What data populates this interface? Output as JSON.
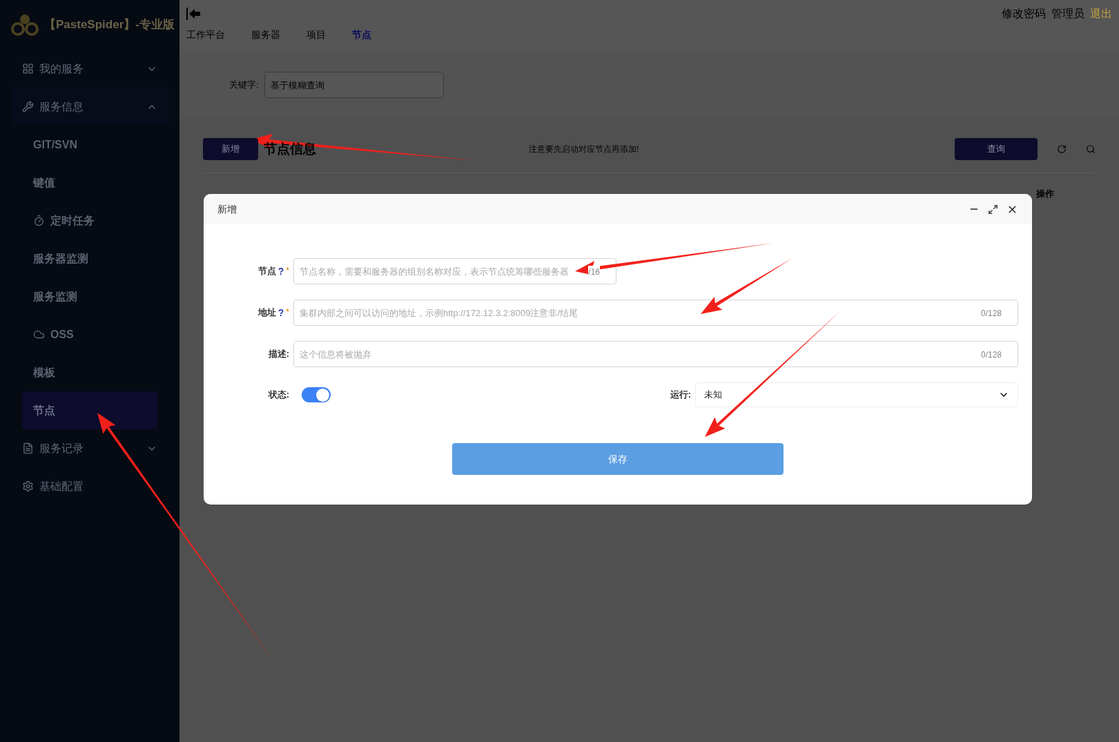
{
  "sidebar": {
    "logo_text": "【PasteSpider】-专业版",
    "items": [
      {
        "label": "我的服务",
        "expanded": false,
        "selected": false
      },
      {
        "label": "服务信息",
        "expanded": true,
        "selected": false,
        "children": [
          {
            "label": "GIT/SVN",
            "selected": false
          },
          {
            "label": "键值",
            "selected": false
          },
          {
            "label": "定时任务",
            "selected": false
          },
          {
            "label": "服务器监测",
            "selected": false
          },
          {
            "label": "服务监测",
            "selected": false
          },
          {
            "label": "OSS",
            "selected": false
          },
          {
            "label": "模板",
            "selected": false
          },
          {
            "label": "节点",
            "selected": true
          }
        ]
      },
      {
        "label": "服务记录",
        "expanded": false,
        "selected": false
      },
      {
        "label": "基础配置",
        "selected": false
      }
    ]
  },
  "topbar": {
    "user_links": [
      {
        "label": "修改密码",
        "kind": "normal"
      },
      {
        "label": "管理员",
        "kind": "normal"
      },
      {
        "label": "退出",
        "kind": "logout"
      }
    ],
    "tabs": [
      {
        "label": "工作平台",
        "selected": false
      },
      {
        "label": "服务器",
        "selected": false
      },
      {
        "label": "项目",
        "selected": false
      },
      {
        "label": "节点",
        "selected": true
      }
    ]
  },
  "filter": {
    "label": "关键字:",
    "placeholder": "基于模糊查询"
  },
  "page": {
    "add_button": "新增",
    "title": "节点信息",
    "subtitle": "注意要先启动对应节点再添加!",
    "search_button": "查询",
    "last_column": "操作"
  },
  "dialog": {
    "title": "新增",
    "fields": [
      {
        "label": "节点",
        "help": "?",
        "required_mark": "*",
        "placeholder": "节点名称，需要和服务器的组别名称对应，表示节点统筹哪些服务器",
        "counter": "/16",
        "wide": false
      },
      {
        "label": "地址",
        "help": "?",
        "required_mark": "*",
        "placeholder": "集群内部之间可以访问的地址，示例http://172.12.3.2:8009注意非/结尾",
        "counter": "0/128",
        "wide": true
      },
      {
        "label": "描述:",
        "placeholder": "这个信息将被抛弃",
        "counter": "0/128",
        "wide": true
      }
    ],
    "status": {
      "label": "状态:",
      "on": true
    },
    "run": {
      "label": "运行:",
      "value": "未知"
    },
    "save_button": "保存"
  }
}
